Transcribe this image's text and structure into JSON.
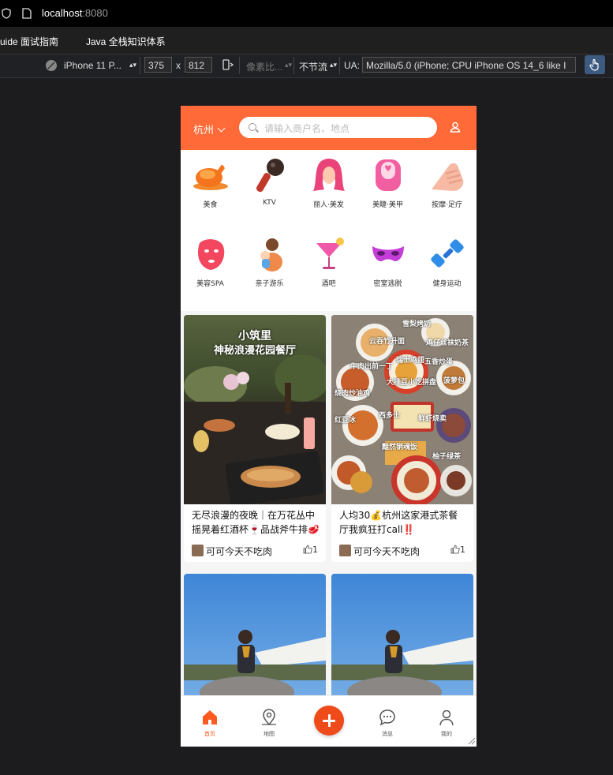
{
  "browser": {
    "url_host": "localhost",
    "url_port": ":8080",
    "bookmarks": [
      "uide 面试指南",
      "Java 全栈知识体系"
    ]
  },
  "devtools": {
    "device": "iPhone 11 P...",
    "width": "375",
    "times": "x",
    "height": "812",
    "dpr": "像素比...",
    "throttle": "不节流",
    "ua_label": "UA:",
    "ua_value": "Mozilla/5.0 (iPhone; CPU iPhone OS 14_6 like I"
  },
  "header": {
    "city": "杭州",
    "search_placeholder": "请输入商户名、地点",
    "accent": "#ff6a38"
  },
  "categories": [
    {
      "label": "美食",
      "icon": "roast-chicken-icon"
    },
    {
      "label": "KTV",
      "icon": "microphone-icon"
    },
    {
      "label": "丽人·美发",
      "icon": "hair-icon"
    },
    {
      "label": "美睫·美甲",
      "icon": "nail-icon"
    },
    {
      "label": "按摩·足疗",
      "icon": "massage-hand-icon"
    },
    {
      "label": "美容SPA",
      "icon": "face-mask-icon"
    },
    {
      "label": "亲子游乐",
      "icon": "parent-child-icon"
    },
    {
      "label": "酒吧",
      "icon": "cocktail-icon"
    },
    {
      "label": "密室逃脱",
      "icon": "mask-icon"
    },
    {
      "label": "健身运动",
      "icon": "dumbbell-icon"
    }
  ],
  "feed": [
    {
      "img_title_1": "小筑里",
      "img_title_2": "神秘浪漫花园餐厅",
      "title": "无尽浪漫的夜晚｜在万花丛中摇晃着红酒杯🍷品战斧牛排🥩",
      "author": "可可今天不吃肉",
      "likes": "1"
    },
    {
      "img_labels": [
        "雪梨烤奶",
        "云吞竹升面",
        "鸡仔丝袜奶茶",
        "牛肉出前一丁",
        "瑞士鸡翅",
        "五香炒蛋",
        "大排豆小吃拼盘",
        "菠萝包",
        "烧肉炒油鸡",
        "西多士",
        "红豆冰",
        "鲜虾烧卖",
        "黯然销魂饭",
        "柚子绿茶"
      ],
      "title": "人均30💰杭州这家港式茶餐厅我疯狂打call‼️",
      "author": "可可今天不吃肉",
      "likes": "1"
    },
    {
      "title": "",
      "author": "",
      "likes": ""
    },
    {
      "title": "",
      "author": "",
      "likes": ""
    }
  ],
  "tabbar": [
    {
      "label": "首页",
      "icon": "home-icon",
      "active": true
    },
    {
      "label": "地图",
      "icon": "map-pin-icon",
      "active": false
    },
    {
      "label": "",
      "icon": "plus-icon",
      "active": false
    },
    {
      "label": "消息",
      "icon": "chat-icon",
      "active": false
    },
    {
      "label": "我的",
      "icon": "user-icon",
      "active": false
    }
  ]
}
